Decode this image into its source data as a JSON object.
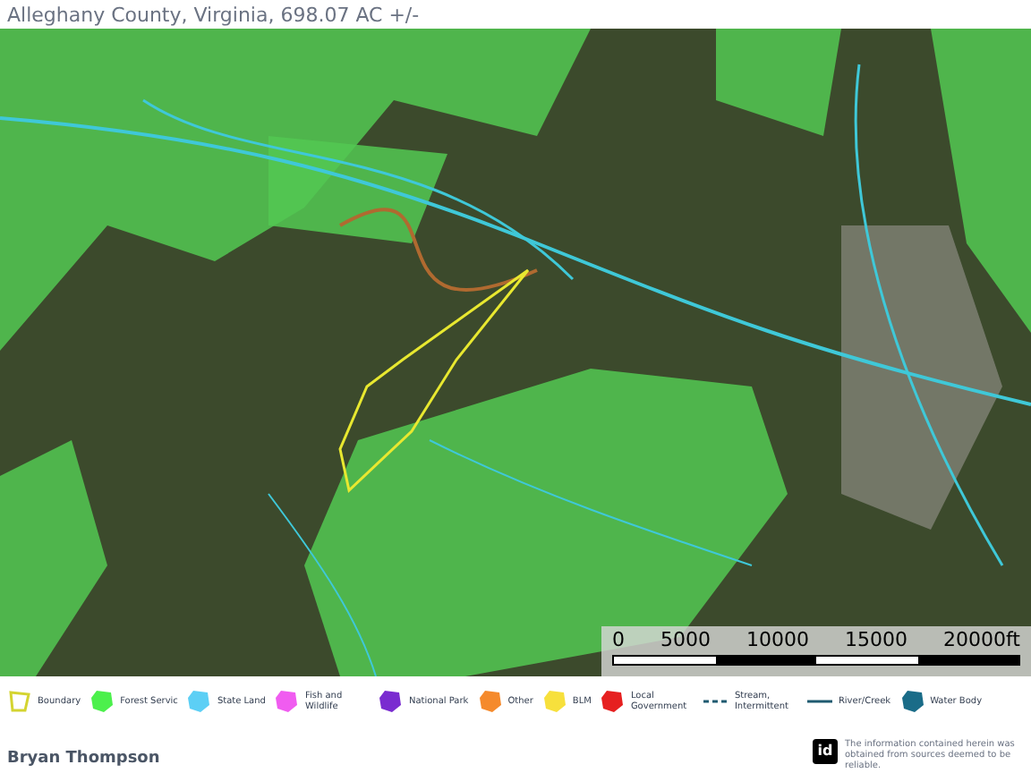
{
  "header": {
    "subtitle": "Alleghany County, Virginia, 698.07 AC +/-"
  },
  "map": {
    "scale_bar": {
      "ticks": [
        "0",
        "5000",
        "10000",
        "15000",
        "20000ft"
      ]
    }
  },
  "legend": [
    {
      "kind": "outline",
      "label": "Boundary",
      "color": "#d4d430"
    },
    {
      "kind": "fill",
      "label": "Forest Servic",
      "color": "#4cf04c"
    },
    {
      "kind": "fill",
      "label": "State Land",
      "color": "#5ccff5"
    },
    {
      "kind": "fill",
      "label": "Fish and Wildlife",
      "color": "#f05cf0"
    },
    {
      "kind": "fill",
      "label": "National Park",
      "color": "#7a2cd0"
    },
    {
      "kind": "fill",
      "label": "Other",
      "color": "#f58a2c"
    },
    {
      "kind": "fill",
      "label": "BLM",
      "color": "#f7e03c"
    },
    {
      "kind": "fill",
      "label": "Local Government",
      "color": "#e62020"
    },
    {
      "kind": "dashed",
      "label": "Stream, Intermittent",
      "color": "#1f5a70"
    },
    {
      "kind": "line",
      "label": "River/Creek",
      "color": "#1f5a70"
    },
    {
      "kind": "fill",
      "label": "Water Body",
      "color": "#1a6c88"
    }
  ],
  "footer": {
    "agent": "Bryan Thompson",
    "logo": "id",
    "disclaimer": "The information contained herein was obtained from sources deemed to be reliable."
  }
}
